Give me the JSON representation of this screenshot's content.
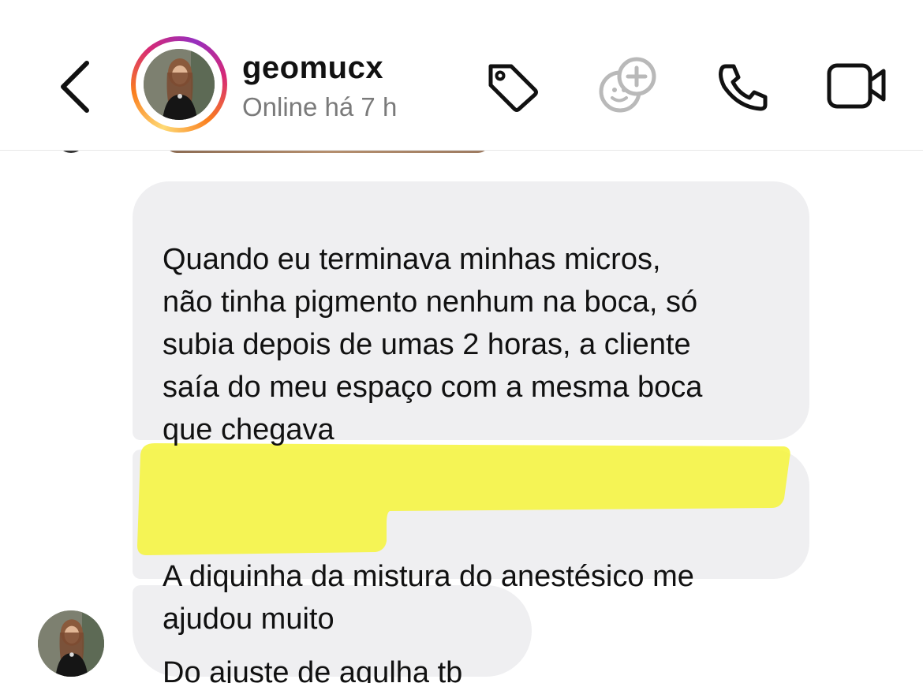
{
  "header": {
    "username": "geomucx",
    "status": "Online há 7 h",
    "icons": [
      "back-chevron-icon",
      "tag-icon",
      "add-sticker-icon",
      "phone-icon",
      "video-camera-icon"
    ]
  },
  "colors": {
    "bubble_bg": "#efeff1",
    "highlight": "#f6f53a",
    "status_text": "#7a7a7a",
    "story_ring": [
      "#feda75",
      "#fa7e1e",
      "#d62976",
      "#962fbf"
    ]
  },
  "messages": [
    {
      "text": "Quando eu terminava minhas micros,\nnão tinha pigmento nenhum na boca, só\nsubia depois de umas 2 horas, a cliente\nsaía do meu espaço com a mesma boca\nque chegava"
    },
    {
      "text": "A diquinha da mistura do anestésico me\najudou muito",
      "highlighted": true
    },
    {
      "text": "Do ajuste de agulha tb"
    }
  ]
}
